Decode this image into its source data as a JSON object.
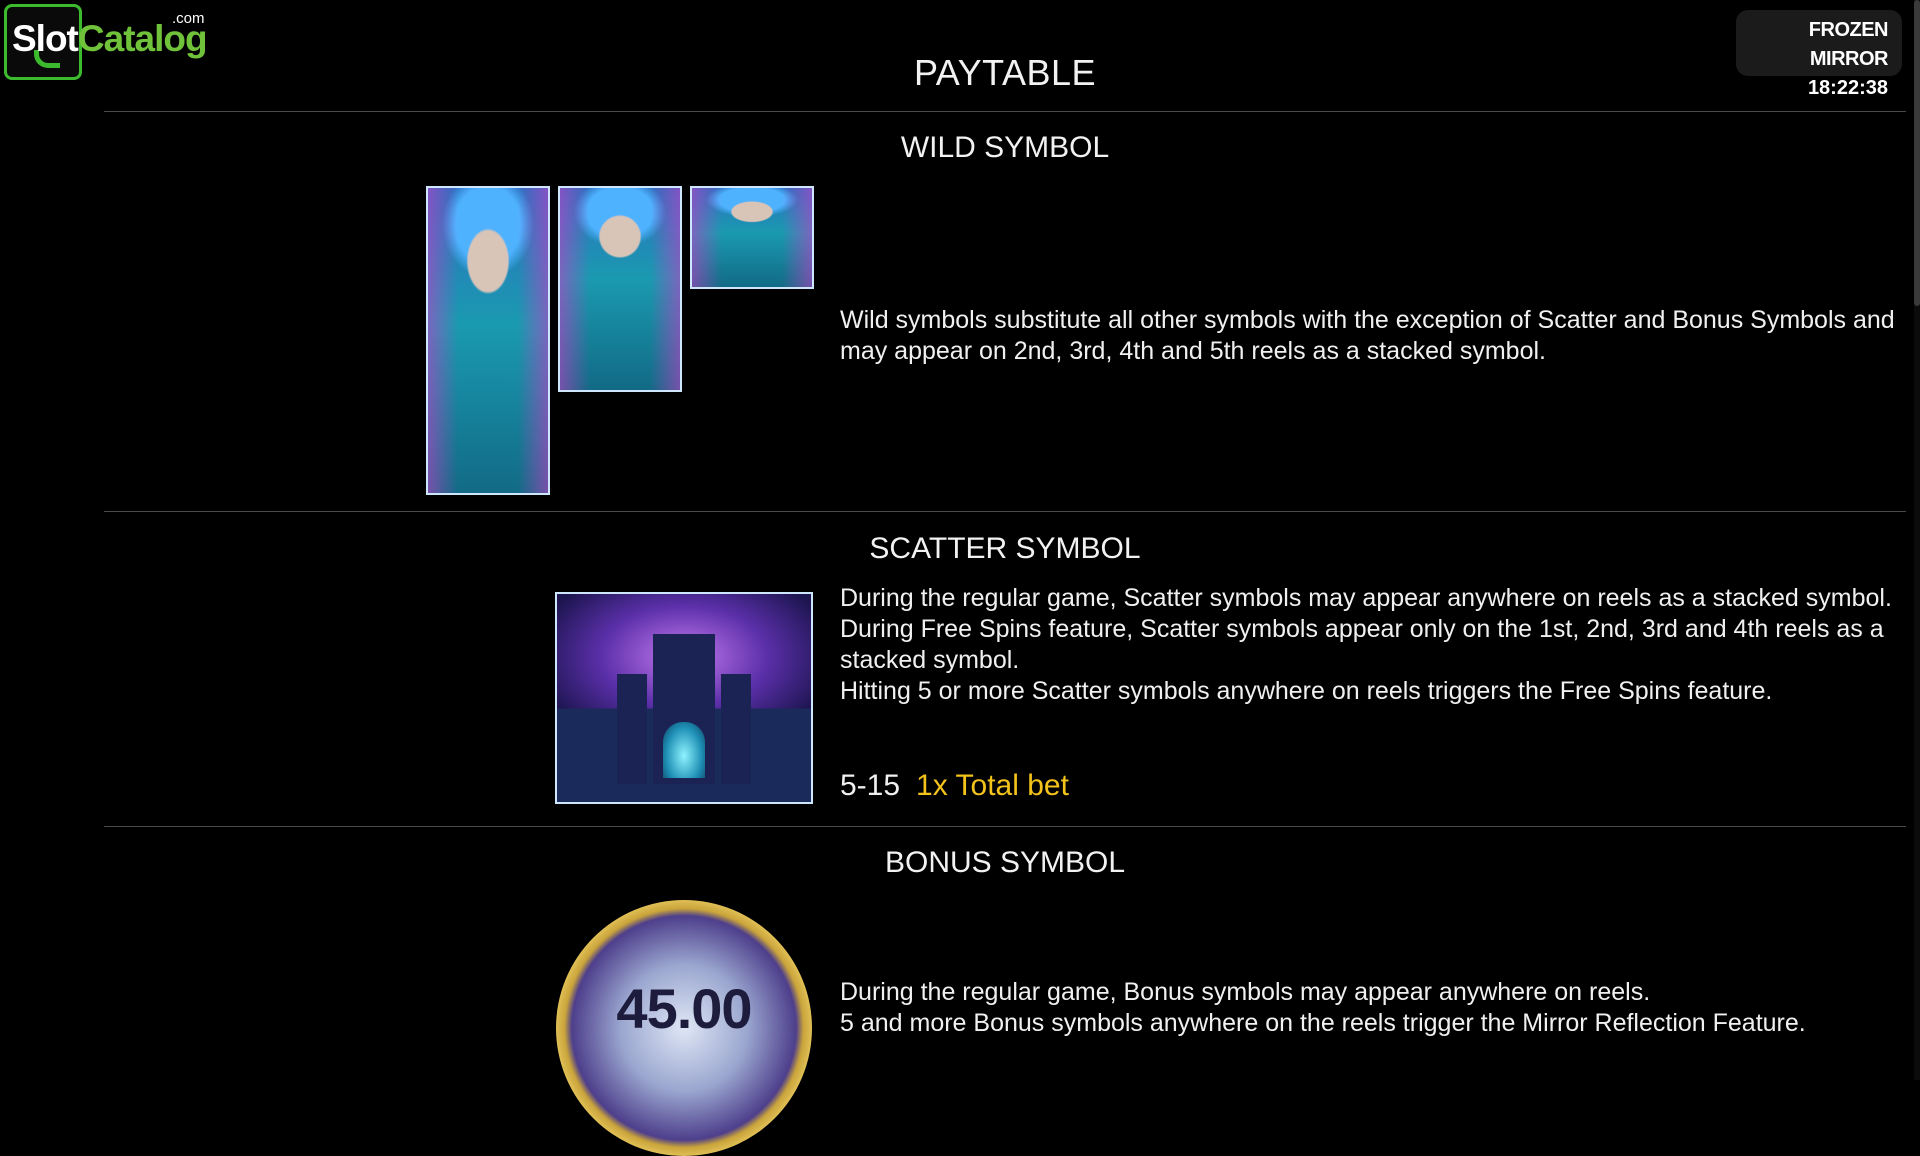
{
  "logo": {
    "brand_left": "Slot",
    "brand_right": "Catalog",
    "suffix": ".com"
  },
  "header": {
    "game_title": "FROZEN MIRROR",
    "clock": "18:22:38"
  },
  "page": {
    "title": "PAYTABLE"
  },
  "sections": {
    "wild": {
      "title": "WILD SYMBOL",
      "description": "Wild symbols substitute all other symbols with the exception of Scatter and Bonus Symbols and may appear on 2nd, 3rd, 4th and 5th reels as a stacked symbol."
    },
    "scatter": {
      "title": "SCATTER SYMBOL",
      "lines": [
        "During the regular game, Scatter symbols may appear anywhere on reels as a stacked symbol.",
        "During Free Spins feature, Scatter symbols appear only on the 1st, 2nd, 3rd and 4th reels as a stacked symbol.",
        "Hitting 5 or more Scatter symbols anywhere on reels triggers the Free Spins feature."
      ],
      "payout": {
        "count": "5-15",
        "value": "1x Total bet"
      }
    },
    "bonus": {
      "title": "BONUS SYMBOL",
      "lines": [
        "During the regular game, Bonus symbols may appear anywhere on reels.",
        "5 and more Bonus symbols anywhere on the reels trigger the Mirror Reflection Feature."
      ],
      "coin_value": "45.00"
    }
  },
  "icons": {
    "logo": "slotcatalog-logo",
    "wild": "ice-queen-symbol",
    "scatter": "ice-castle-symbol",
    "bonus": "bonus-coin-symbol"
  },
  "colors": {
    "background": "#000000",
    "payout_highlight": "#f3c21b",
    "logo_green": "#3dbb2f",
    "divider": "#4a4a4a"
  }
}
